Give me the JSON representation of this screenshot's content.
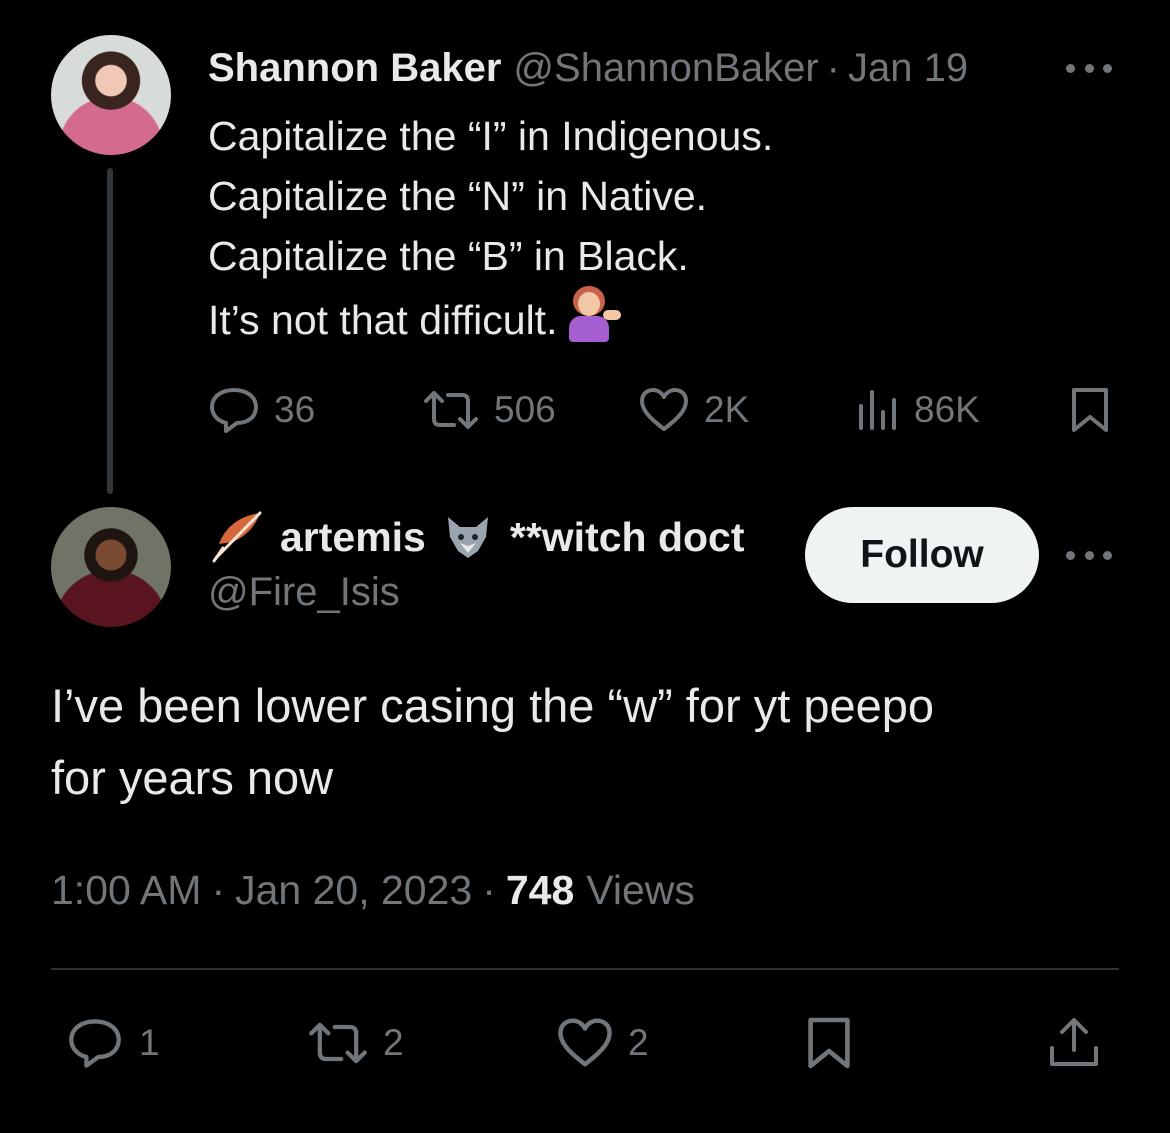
{
  "parent": {
    "name": "Shannon Baker",
    "handle": "@ShannonBaker",
    "separator": "·",
    "date": "Jan 19",
    "lines": [
      "Capitalize the “I” in Indigenous.",
      "Capitalize the “N” in Native.",
      "Capitalize the “B” in Black.",
      "It’s not that difficult."
    ],
    "emoji_icon": "woman-tipping-hand-emoji",
    "replies": "36",
    "reposts": "506",
    "likes": "2K",
    "views": "86K"
  },
  "reply": {
    "name_part1": "artemis",
    "name_part2": "**witch doct",
    "name_icons": [
      "feather-icon",
      "wolf-icon"
    ],
    "handle": "@Fire_Isis",
    "follow_label": "Follow",
    "text_line1": "I’ve been lower casing the “w” for yt peepo",
    "text_line2": "for years now",
    "time": "1:00 AM",
    "separator": "·",
    "date": "Jan 20, 2023",
    "view_count": "748",
    "views_label": "Views",
    "replies": "1",
    "reposts": "2",
    "likes": "2"
  },
  "colors": {
    "background": "#000000",
    "text": "#e7e9ea",
    "secondary": "#71767b",
    "divider": "#2f3336",
    "follow_bg": "#eff3f4"
  }
}
